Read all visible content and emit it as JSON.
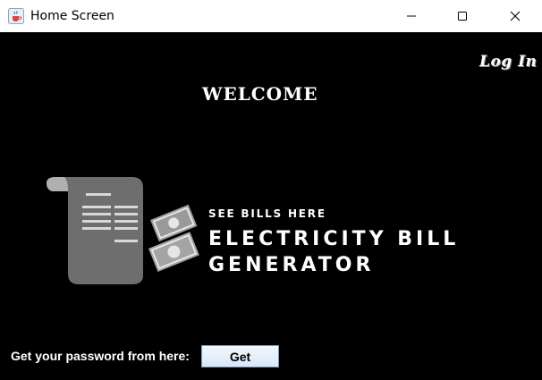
{
  "window": {
    "title": "Home Screen",
    "app_icon": "java-cup-icon",
    "controls": [
      "minimize-icon",
      "maximize-icon",
      "close-icon"
    ]
  },
  "header": {
    "login_label": "Log In",
    "welcome_text": "WELCOME"
  },
  "banner": {
    "tagline": "SEE BILLS HERE",
    "brand_line1": "ELECTRICITY BILL",
    "brand_line2": "GENERATOR",
    "illustration": "bill-and-money-icon"
  },
  "footer": {
    "password_label": "Get your password from here:",
    "get_button_label": "Get"
  }
}
